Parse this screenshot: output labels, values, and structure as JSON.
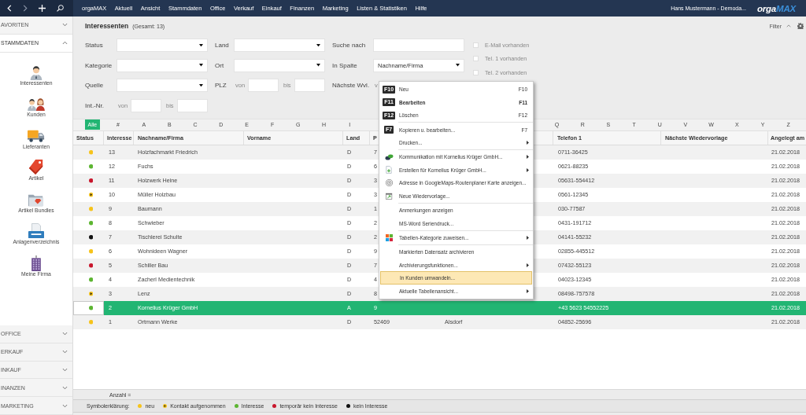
{
  "topbar": {
    "menu": [
      "orgaMAX",
      "Aktuell",
      "Ansicht",
      "Stammdaten",
      "Office",
      "Verkauf",
      "Einkauf",
      "Finanzen",
      "Marketing",
      "Listen & Statistiken",
      "Hilfe"
    ],
    "user": "Hans Mustermann - Demoda...",
    "logo": [
      "orga",
      "MAX"
    ]
  },
  "sidebar": {
    "sections": [
      {
        "label": "AVORITEN",
        "expanded": false
      },
      {
        "label": "STAMMDATEN",
        "expanded": true,
        "items": [
          "Interessenten",
          "Kunden",
          "Lieferanten",
          "Artikel",
          "Artikel Bundles",
          "Anlagenverzeichnis",
          "Meine Firma"
        ]
      },
      {
        "label": "OFFICE",
        "expanded": false
      },
      {
        "label": "ERKAUF",
        "expanded": false
      },
      {
        "label": "INKAUF",
        "expanded": false
      },
      {
        "label": "INANZEN",
        "expanded": false
      },
      {
        "label": "MARKETING",
        "expanded": false
      }
    ]
  },
  "page": {
    "title": "Interessenten",
    "count": "(Gesamt: 13)"
  },
  "filter_panel": {
    "label": "Filter",
    "expanded": true
  },
  "filters": {
    "status": {
      "label": "Status"
    },
    "land": {
      "label": "Land"
    },
    "suche_nach": {
      "label": "Suche nach"
    },
    "kategorie": {
      "label": "Kategorie"
    },
    "ort": {
      "label": "Ort"
    },
    "in_spalte": {
      "label": "In Spalte",
      "value": "Nachname/Firma"
    },
    "quelle": {
      "label": "Quelle"
    },
    "plz": {
      "label": "PLZ",
      "from": "von",
      "to": "bis"
    },
    "naechste_wvl": {
      "label": "Nächste Wvl.",
      "from": "v"
    },
    "int_nr": {
      "label": "Int.-Nr.",
      "from": "von",
      "to": "bis"
    },
    "checkboxes": [
      {
        "label": "E-Mail vorhanden",
        "checked": false
      },
      {
        "label": "Tel. 1 vorhanden",
        "checked": false
      },
      {
        "label": "Tel. 2 vorhanden",
        "checked": false
      }
    ]
  },
  "alphabet": {
    "groups": [
      [
        {
          "label": "Alle",
          "selected": true
        },
        {
          "label": "#",
          "selected": false
        },
        {
          "label": "A",
          "selected": false
        },
        {
          "label": "B",
          "selected": false
        },
        {
          "label": "C",
          "selected": false
        },
        {
          "label": "D",
          "selected": false
        },
        {
          "label": "E",
          "selected": false
        },
        {
          "label": "F",
          "selected": false
        },
        {
          "label": "G",
          "selected": false
        },
        {
          "label": "H",
          "selected": false
        },
        {
          "label": "I",
          "selected": false
        }
      ],
      [
        {
          "label": "Q",
          "selected": false
        },
        {
          "label": "R",
          "selected": false
        },
        {
          "label": "S",
          "selected": false
        },
        {
          "label": "T",
          "selected": false
        },
        {
          "label": "U",
          "selected": false
        },
        {
          "label": "V",
          "selected": false
        },
        {
          "label": "W",
          "selected": false
        },
        {
          "label": "X",
          "selected": false
        },
        {
          "label": "Y",
          "selected": false
        },
        {
          "label": "Z",
          "selected": false
        }
      ]
    ]
  },
  "table": {
    "columns": [
      "Status",
      "Interesse",
      "Nachname/Firma",
      "Vorname",
      "Land",
      "P",
      "Telefon 1",
      "Nächste Wiedervorlage",
      "Angelegt am"
    ],
    "rows": [
      {
        "status": {
          "kind": "dot",
          "color": "#f6c31a"
        },
        "interesse": "13",
        "name": "Holzfachmarkt Friedrich",
        "land": "D",
        "plz": "7",
        "telefon": "0711-36425",
        "angelegt": "21.02.2018",
        "selected": false
      },
      {
        "status": {
          "kind": "dot",
          "color": "#5cb531"
        },
        "interesse": "12",
        "name": "Fuchs",
        "land": "D",
        "plz": "6",
        "telefon": "0621-88235",
        "angelegt": "21.02.2018",
        "selected": false
      },
      {
        "status": {
          "kind": "dot",
          "color": "#c8162c"
        },
        "interesse": "11",
        "name": "Holzwerk Heine",
        "land": "D",
        "plz": "3",
        "telefon": "05631-554412",
        "angelegt": "21.02.2018",
        "selected": false
      },
      {
        "status": {
          "kind": "split",
          "color": "#f6c31a"
        },
        "interesse": "10",
        "name": "Müller Holzbau",
        "land": "D",
        "plz": "3",
        "telefon": "0561-12345",
        "angelegt": "21.02.2018",
        "selected": false
      },
      {
        "status": {
          "kind": "dot",
          "color": "#f6c31a"
        },
        "interesse": "9",
        "name": "Baumann",
        "land": "D",
        "plz": "1",
        "telefon": "030-77587",
        "angelegt": "21.02.2018",
        "selected": false
      },
      {
        "status": {
          "kind": "dot",
          "color": "#5cb531"
        },
        "interesse": "8",
        "name": "Schwieber",
        "land": "D",
        "plz": "2",
        "telefon": "0431-191712",
        "angelegt": "21.02.2018",
        "selected": false
      },
      {
        "status": {
          "kind": "dot",
          "color": "#111111"
        },
        "interesse": "7",
        "name": "Tischlerei Schulte",
        "land": "D",
        "plz": "2",
        "telefon": "04141-55232",
        "angelegt": "21.02.2018",
        "selected": false
      },
      {
        "status": {
          "kind": "dot",
          "color": "#f6c31a"
        },
        "interesse": "6",
        "name": "Wohnideen Wagner",
        "land": "D",
        "plz": "9",
        "telefon": "02855-445512",
        "angelegt": "21.02.2018",
        "selected": false
      },
      {
        "status": {
          "kind": "dot",
          "color": "#c8162c"
        },
        "interesse": "5",
        "name": "Schiller Bau",
        "land": "D",
        "plz": "7",
        "telefon": "07432-55123",
        "angelegt": "21.02.2018",
        "selected": false
      },
      {
        "status": {
          "kind": "dot",
          "color": "#5cb531"
        },
        "interesse": "4",
        "name": "Zacherl Medientechnik",
        "land": "D",
        "plz": "4",
        "telefon": "04023-12345",
        "angelegt": "21.02.2018",
        "selected": false
      },
      {
        "status": {
          "kind": "split",
          "color": "#f6c31a"
        },
        "interesse": "3",
        "name": "Lenz",
        "land": "D",
        "plz": "8",
        "telefon": "08498-757578",
        "angelegt": "21.02.2018",
        "selected": false
      },
      {
        "status": {
          "kind": "dot",
          "color": "#5cb531"
        },
        "interesse": "2",
        "name": "Kornelius Krüger GmbH",
        "land": "A",
        "plz": "9",
        "telefon": "+43 5623 54552225",
        "angelegt": "21.02.2018",
        "selected": true
      },
      {
        "status": {
          "kind": "dot",
          "color": "#f6c31a"
        },
        "interesse": "1",
        "name": "Ortmann Werke",
        "land": "D",
        "plz": "52469",
        "ort": "Alsdorf",
        "telefon": "04852-25696",
        "angelegt": "21.02.2018",
        "selected": false
      }
    ],
    "count_label": "Anzahl ="
  },
  "legend": {
    "title": "Symbolerklärung:",
    "items": [
      {
        "label": "neu",
        "kind": "dot",
        "color": "#f6c31a"
      },
      {
        "label": "Kontakt aufgenommen",
        "kind": "split",
        "color": "#f6c31a"
      },
      {
        "label": "Interesse",
        "kind": "dot",
        "color": "#5cb531"
      },
      {
        "label": "temporär kein Interesse",
        "kind": "dot",
        "color": "#c8162c"
      },
      {
        "label": "kein Interesse",
        "kind": "dot",
        "color": "#111111"
      }
    ]
  },
  "context_menu": {
    "groups": [
      [
        {
          "label": "Neu",
          "kind": "key",
          "key": "F10",
          "shortcut": "F10",
          "default": false,
          "selected": false,
          "submenu": false
        },
        {
          "label": "Bearbeiten",
          "kind": "key",
          "key": "F11",
          "shortcut": "F11",
          "default": true,
          "selected": false,
          "submenu": false
        },
        {
          "label": "Löschen",
          "kind": "key",
          "key": "F12",
          "shortcut": "F12",
          "default": false,
          "selected": false,
          "submenu": false
        }
      ],
      [
        {
          "label": "Kopieren u. bearbeiten...",
          "kind": "key",
          "key": "F7",
          "shortcut": "F7",
          "default": false,
          "selected": false,
          "submenu": false
        },
        {
          "label": "Drucken...",
          "kind": "plain",
          "default": false,
          "selected": false,
          "submenu": true
        }
      ],
      [
        {
          "label": "Kommunikation mit Kornelius Krüger GmbH...",
          "kind": "communication",
          "default": false,
          "selected": false,
          "submenu": true
        },
        {
          "label": "Erstellen für Kornelius Krüger GmbH...",
          "kind": "create",
          "default": false,
          "selected": false,
          "submenu": true
        },
        {
          "label": "Adresse in GoogleMaps-Routenplaner Karte anzeigen...",
          "kind": "map",
          "default": false,
          "selected": false,
          "submenu": false
        },
        {
          "label": "Neue Wiedervorlage...",
          "kind": "reminder",
          "default": false,
          "selected": false,
          "submenu": false
        }
      ],
      [
        {
          "label": "Anmerkungen anzeigen",
          "kind": "plain",
          "default": false,
          "selected": false,
          "submenu": false
        },
        {
          "label": "MS-Word Seriendruck...",
          "kind": "plain",
          "default": false,
          "selected": false,
          "submenu": false
        }
      ],
      [
        {
          "label": "Tabellen-Kategorie zuweisen...",
          "kind": "category",
          "default": false,
          "selected": false,
          "submenu": true
        }
      ],
      [
        {
          "label": "Markierten Datensatz archivieren",
          "kind": "plain",
          "default": false,
          "selected": false,
          "submenu": false
        },
        {
          "label": "Archivierungsfunktionen...",
          "kind": "plain",
          "default": false,
          "selected": false,
          "submenu": true
        },
        {
          "label": "In Kunden umwandeln...",
          "kind": "plain",
          "default": false,
          "selected": true,
          "submenu": false
        },
        {
          "label": "Aktuelle Tabellenansicht...",
          "kind": "plain",
          "default": false,
          "selected": false,
          "submenu": true
        }
      ]
    ]
  }
}
